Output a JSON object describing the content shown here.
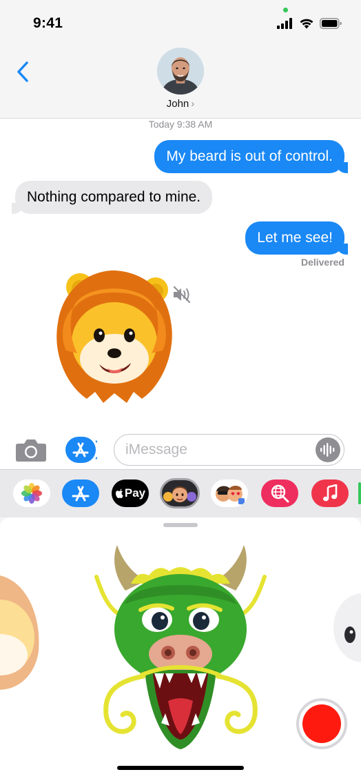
{
  "status_bar": {
    "time": "9:41",
    "icons": [
      "signal-icon",
      "wifi-icon",
      "battery-icon"
    ],
    "camera_indicator_color": "#34c759"
  },
  "header": {
    "back_icon": "chevron-left-icon",
    "contact_name": "John",
    "chevron": "›",
    "accent_color": "#1a88f5"
  },
  "conversation": {
    "timestamp": "Today 9:38 AM",
    "messages": [
      {
        "direction": "outgoing",
        "text": "My beard is out of control."
      },
      {
        "direction": "incoming",
        "text": "Nothing compared to mine."
      },
      {
        "direction": "outgoing",
        "text": "Let me see!"
      }
    ],
    "delivery_status": "Delivered",
    "animoji_message": {
      "character": "lion",
      "audio_state": "muted"
    }
  },
  "compose": {
    "camera_icon": "camera-icon",
    "apps_icon": "app-store-icon",
    "placeholder": "iMessage",
    "audio_icon": "waveform-icon"
  },
  "app_drawer": {
    "apps": [
      {
        "name": "photos",
        "icon": "photos-icon"
      },
      {
        "name": "app-store",
        "icon": "app-store-icon"
      },
      {
        "name": "apple-pay",
        "icon": "apple-pay-icon",
        "label": "Pay"
      },
      {
        "name": "memoji",
        "icon": "memoji-icon",
        "selected": true
      },
      {
        "name": "memoji-stickers",
        "icon": "memoji-stickers-icon"
      },
      {
        "name": "images-search",
        "icon": "globe-search-icon"
      },
      {
        "name": "music",
        "icon": "music-note-icon"
      }
    ]
  },
  "animoji_panel": {
    "selected_character": "dragon",
    "adjacent_left": "lion",
    "adjacent_right": "unicorn",
    "record_color": "#ff1a0f"
  }
}
